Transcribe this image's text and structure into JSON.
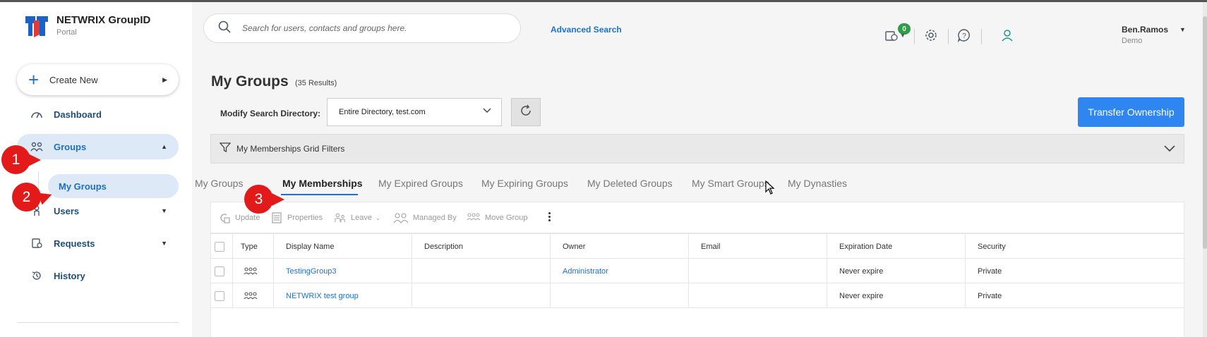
{
  "logo": {
    "title": "NETWRIX GroupID",
    "subtitle": "Portal"
  },
  "create_new": {
    "label": "Create New"
  },
  "sidebar": {
    "items": [
      {
        "label": "Dashboard",
        "icon": "dashboard-icon"
      },
      {
        "label": "Groups",
        "icon": "groups-icon",
        "active": true
      },
      {
        "label": "Users",
        "icon": "user-icon"
      },
      {
        "label": "Requests",
        "icon": "requests-icon"
      },
      {
        "label": "History",
        "icon": "history-icon"
      }
    ],
    "sub_item": "My Groups"
  },
  "search": {
    "placeholder": "Search for users, contacts and groups here.",
    "advanced_label": "Advanced Search"
  },
  "header": {
    "notification_count": "0",
    "user_name": "Ben.Ramos",
    "user_sub": "Demo"
  },
  "page": {
    "title": "My Groups",
    "result_count": "(35 Results)"
  },
  "modify": {
    "label": "Modify Search Directory:",
    "selected": "Entire Directory, test.com"
  },
  "transfer_button": "Transfer Ownership",
  "filter": {
    "label": "My Memberships Grid Filters"
  },
  "tabs": [
    {
      "label": "My Groups"
    },
    {
      "label": "My Memberships",
      "active": true
    },
    {
      "label": "My Expired Groups"
    },
    {
      "label": "My Expiring Groups"
    },
    {
      "label": "My Deleted Groups"
    },
    {
      "label": "My Smart Groups"
    },
    {
      "label": "My Dynasties"
    }
  ],
  "toolbar": {
    "update": "Update",
    "properties": "Properties",
    "leave": "Leave",
    "managed_by": "Managed By",
    "move_group": "Move Group"
  },
  "table": {
    "columns": [
      "Type",
      "Display Name",
      "Description",
      "Owner",
      "Email",
      "Expiration Date",
      "Security"
    ],
    "rows": [
      {
        "display_name": "TestingGroup3",
        "description": "",
        "owner": "Administrator",
        "email": "",
        "expiration": "Never expire",
        "security": "Private"
      },
      {
        "display_name": "NETWRIX test group",
        "description": "",
        "owner": "",
        "email": "",
        "expiration": "Never expire",
        "security": "Private"
      }
    ]
  },
  "annotations": {
    "step1": "1",
    "step2": "2",
    "step3": "3"
  },
  "colors": {
    "accent": "#1b72d6",
    "primary_button": "#2f86f0",
    "badge": "#2e9e44",
    "callout": "#e21a1a",
    "nav_active_bg": "#dde9f7"
  }
}
